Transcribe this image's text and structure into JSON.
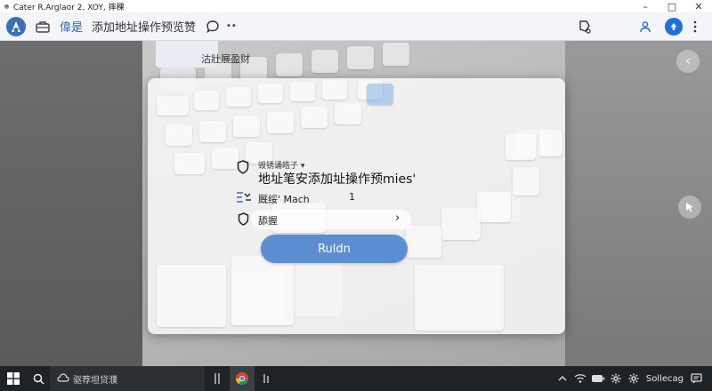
{
  "window": {
    "title": "Cater R.Arglaor 2, XOY, 摔稞",
    "minimize_glyph": "–",
    "maximize_glyph": "□",
    "close_glyph": "✕"
  },
  "toolbar": {
    "nav_label": "偉是",
    "page_label": "添加地址操作预览赞",
    "more_glyph": "••"
  },
  "background": {
    "chip_label": "沽壯展盈财"
  },
  "dialog": {
    "field1_label": "毁锈诵皓子 ▾",
    "field1_value": "地址笔安添加址操作预mies'",
    "field2_label": "厩绥' Mach",
    "field2_suffix": "1",
    "field3_label": "舔握",
    "field3_arrow": "›",
    "run_button": "Ruldn"
  },
  "taskbar": {
    "search_text": "驱荐坦贷濮",
    "tray_text": "Sollecag"
  },
  "colors": {
    "accent": "#3b6fb6",
    "button": "#5b8fd2",
    "taskbar": "#1f2226"
  }
}
